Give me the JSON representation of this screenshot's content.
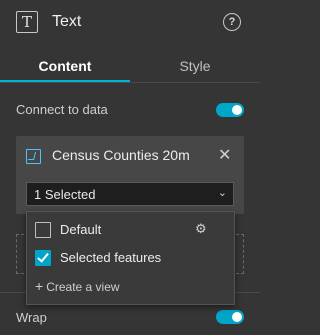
{
  "header": {
    "icon_glyph": "T",
    "icon": "text-widget-icon",
    "title": "Text",
    "help_glyph": "?"
  },
  "tabs": [
    {
      "label": "Content",
      "active": true
    },
    {
      "label": "Style",
      "active": false
    }
  ],
  "connect": {
    "label": "Connect to data",
    "enabled": true
  },
  "datasource": {
    "icon": "feature-layer-icon",
    "name": "Census Counties 20m",
    "close_glyph": "✕",
    "select_value": "1 Selected",
    "chevron_glyph": "⌄"
  },
  "dropdown": {
    "options": [
      {
        "label": "Default",
        "checked": false,
        "gear_glyph": "⚙"
      },
      {
        "label": "Selected features",
        "checked": true
      }
    ],
    "create_plus": "+",
    "create_label": "Create a view"
  },
  "wrap": {
    "label": "Wrap",
    "enabled": true
  },
  "colors": {
    "accent": "#00a6c8",
    "background": "#353535",
    "panel": "#474747"
  }
}
